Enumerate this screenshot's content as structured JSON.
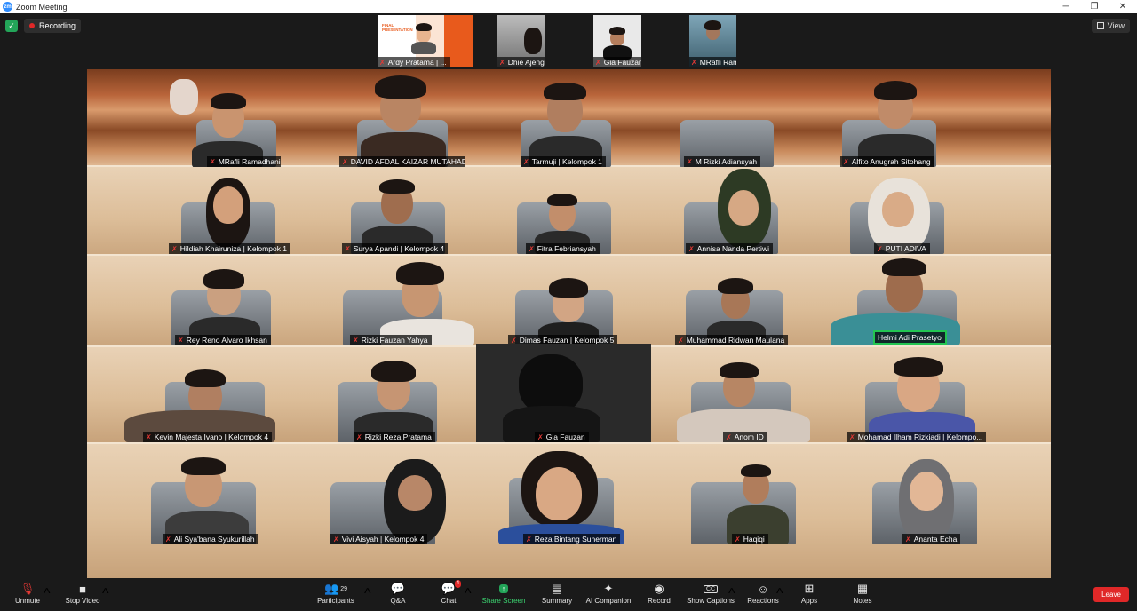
{
  "window": {
    "title": "Zoom Meeting",
    "logo_text": "zm",
    "controls": [
      "─",
      "❐",
      "✕"
    ]
  },
  "meeting": {
    "recording_label": "Recording",
    "view_label": "View"
  },
  "top_strip": [
    {
      "name": "Ardy Pratama | ...",
      "slide_text": "FINAL PRESENTATION"
    },
    {
      "name": "Dhie Ajeng"
    },
    {
      "name": "Gia Fauzan"
    },
    {
      "name": "MRafli Ramadh..."
    }
  ],
  "rows": [
    [
      "MRafli Ramadhani",
      "DAVID AFDAL KAIZAR MUTAHADI",
      "Tarmuji | Kelompok 1",
      "M Rizki Adiansyah",
      "Alfito Anugrah Sitohang"
    ],
    [
      "Hildiah Khairuniza | Kelompok 1",
      "Surya Apandi | Kelompok 4",
      "Fitra Febriansyah",
      "Annisa Nanda Pertiwi",
      "PUTI ADIVA"
    ],
    [
      "Rey Reno Alvaro Ikhsan",
      "Rizki Fauzan Yahya",
      "Dimas Fauzan | Kelompok 5",
      "Muhammad Ridwan Maulana",
      "Helmi Adi Prasetyo"
    ],
    [
      "Kevin Majesta Ivano | Kelompok 4",
      "Rizki Reza Pratama",
      "Gia Fauzan",
      "Anom ID",
      "Mohamad Ilham Rizkiadi | Kelompo..."
    ],
    [
      "Ali Sya'bana Syukurillah",
      "Vivi Aisyah | Kelompok 4",
      "Reza Bintang Suherman",
      "Haqiqi",
      "Ananta Echa"
    ]
  ],
  "toolbar": {
    "unmute": "Unmute",
    "stop_video": "Stop Video",
    "participants": "Participants",
    "participants_count": "29",
    "qa": "Q&A",
    "chat": "Chat",
    "chat_badge": "4",
    "share_screen": "Share Screen",
    "summary": "Summary",
    "ai_companion": "AI Companion",
    "record": "Record",
    "show_captions": "Show Captions",
    "reactions": "Reactions",
    "apps": "Apps",
    "notes": "Notes",
    "leave": "Leave"
  },
  "colors": {
    "accent_green": "#23a559",
    "leave_red": "#e02828",
    "mic_off_red": "#e53935",
    "speaker_outline": "#23c552"
  },
  "icons": [
    "shield-icon",
    "record-dot-icon",
    "grid-icon",
    "mic-off-icon",
    "video-icon",
    "participants-icon",
    "qa-icon",
    "chat-icon",
    "share-icon",
    "summary-icon",
    "ai-companion-icon",
    "record-icon",
    "captions-icon",
    "reactions-icon",
    "apps-icon",
    "notes-icon"
  ]
}
